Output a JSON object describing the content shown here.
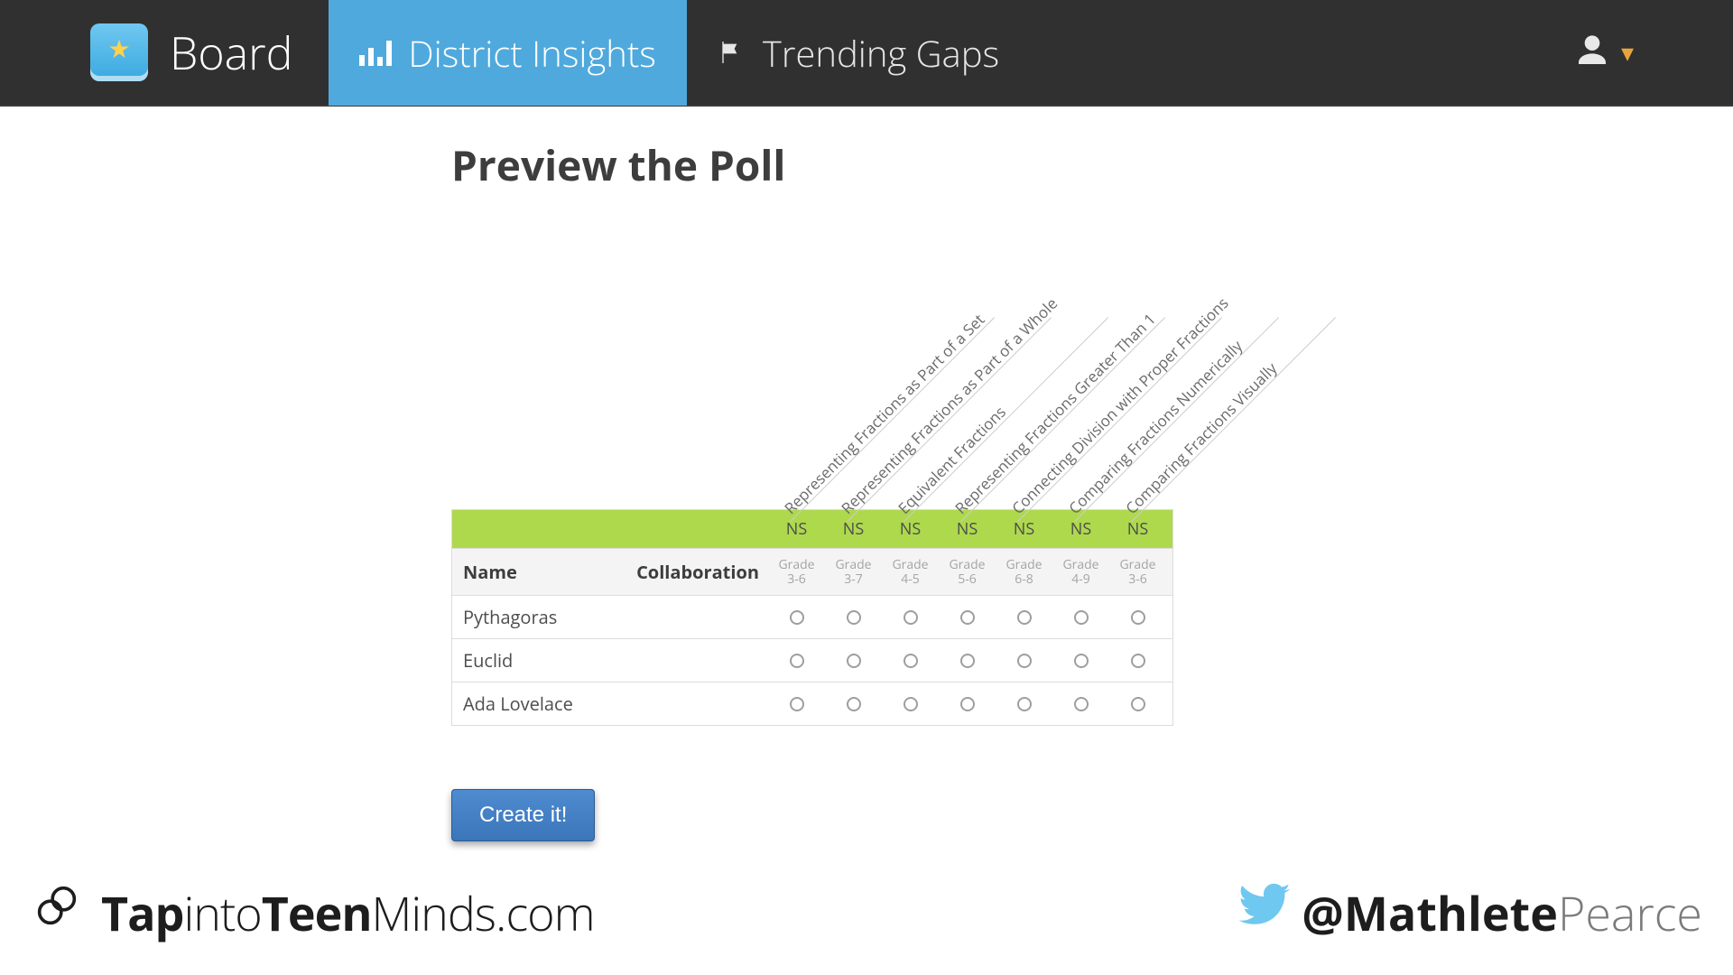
{
  "navbar": {
    "brand": "Board",
    "items": [
      {
        "label": "District Insights",
        "active": true
      },
      {
        "label": "Trending Gaps",
        "active": false
      }
    ]
  },
  "page": {
    "title": "Preview the Poll",
    "create_button": "Create it!"
  },
  "poll": {
    "columns": [
      {
        "label": "Representing Fractions as Part of a Set",
        "ns": "NS",
        "grade_line1": "Grade",
        "grade_line2": "3-6"
      },
      {
        "label": "Representing Fractions as Part of a Whole",
        "ns": "NS",
        "grade_line1": "Grade",
        "grade_line2": "3-7"
      },
      {
        "label": "Equivalent Fractions",
        "ns": "NS",
        "grade_line1": "Grade",
        "grade_line2": "4-5"
      },
      {
        "label": "Representing Fractions Greater Than 1",
        "ns": "NS",
        "grade_line1": "Grade",
        "grade_line2": "5-6"
      },
      {
        "label": "Connecting Division with Proper Fractions",
        "ns": "NS",
        "grade_line1": "Grade",
        "grade_line2": "6-8"
      },
      {
        "label": "Comparing Fractions Numerically",
        "ns": "NS",
        "grade_line1": "Grade",
        "grade_line2": "4-9"
      },
      {
        "label": "Comparing Fractions Visually",
        "ns": "NS",
        "grade_line1": "Grade",
        "grade_line2": "3-6"
      }
    ],
    "stub": {
      "name_header": "Name",
      "collab_header": "Collaboration"
    },
    "rows": [
      {
        "name": "Pythagoras"
      },
      {
        "name": "Euclid"
      },
      {
        "name": "Ada Lovelace"
      }
    ]
  },
  "footer": {
    "left_thin1": "Tap",
    "left_thin2": "into",
    "left_bold": "Teen",
    "left_thin3": "Minds",
    "left_tld": ".com",
    "twitter_at": "@",
    "twitter_bold": "Mathlete",
    "twitter_thin": "Pearce"
  }
}
